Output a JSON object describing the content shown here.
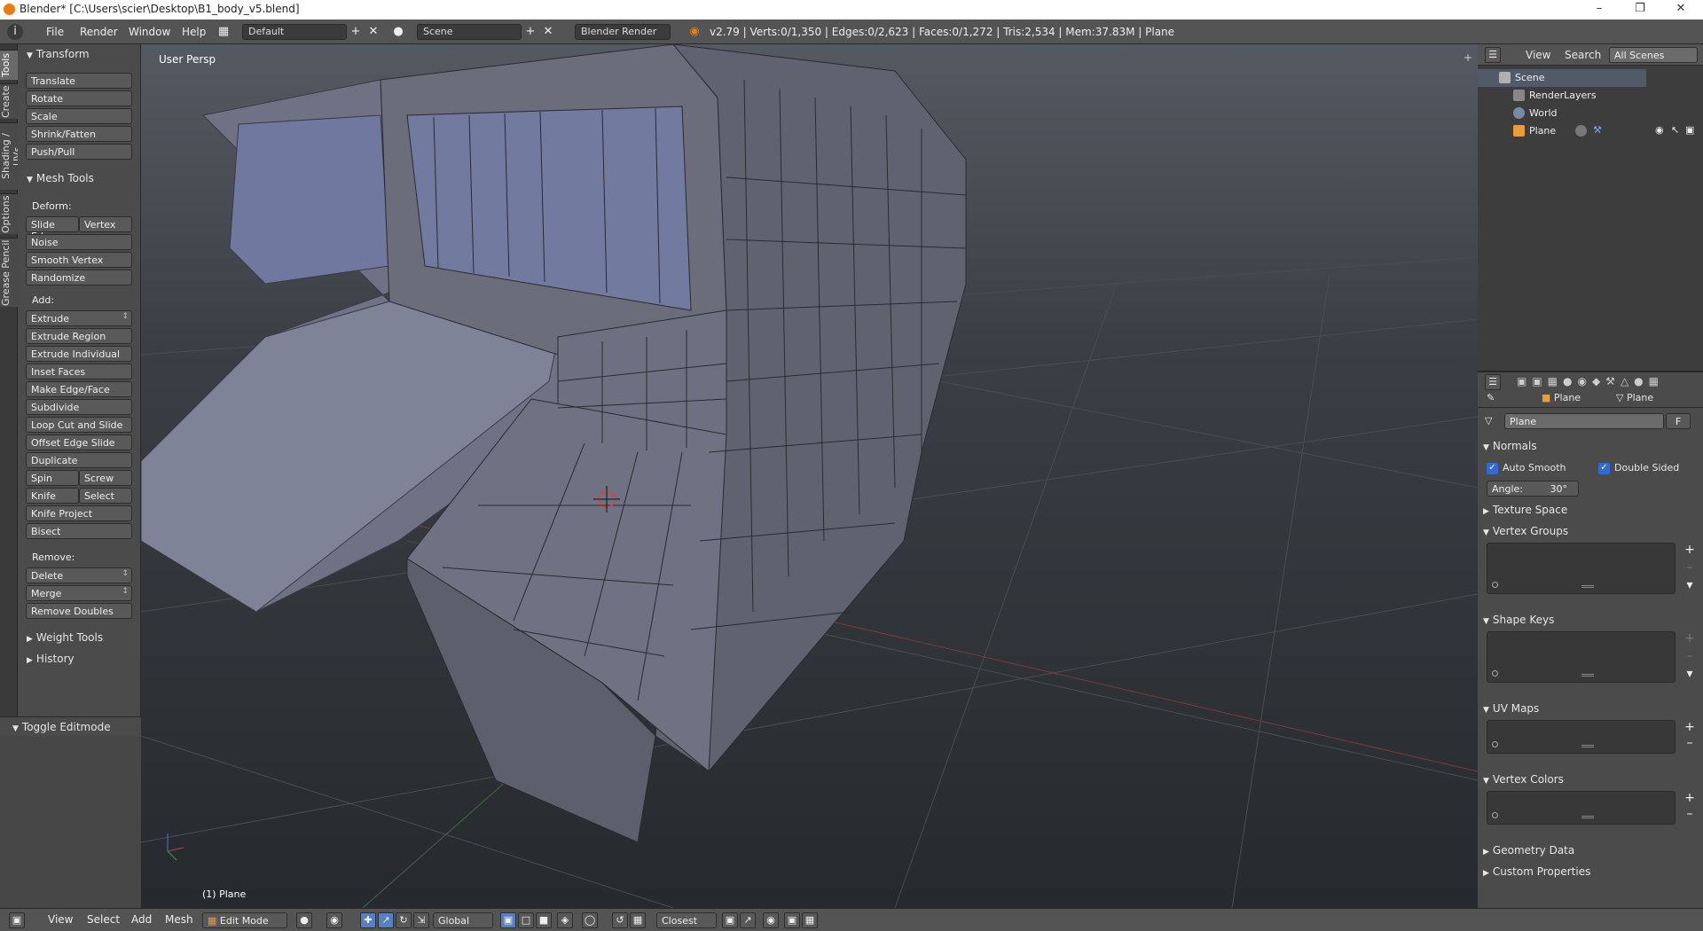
{
  "window": {
    "title": "Blender* [C:\\Users\\scier\\Desktop\\B1_body_v5.blend]"
  },
  "infobar": {
    "menus": [
      "File",
      "Render",
      "Window",
      "Help"
    ],
    "screen_layout": "Default",
    "scene": "Scene",
    "render_engine": "Blender Render",
    "stats": "v2.79 | Verts:0/1,350 | Edges:0/2,623 | Faces:0/1,272 | Tris:2,534 | Mem:37.83M | Plane"
  },
  "tabs": [
    "Tools",
    "Create",
    "Shading / UVs",
    "Options",
    "Grease Pencil"
  ],
  "toolshelf": {
    "transform": {
      "title": "Transform",
      "buttons": [
        "Translate",
        "Rotate",
        "Scale",
        "Shrink/Fatten",
        "Push/Pull"
      ]
    },
    "mesh_tools": {
      "title": "Mesh Tools",
      "deform_label": "Deform:",
      "deform": {
        "slide_edge": "Slide Edge",
        "vertex": "Vertex",
        "noise": "Noise",
        "smooth_vertex": "Smooth Vertex",
        "randomize": "Randomize"
      },
      "add_label": "Add:",
      "add": {
        "extrude": "Extrude",
        "extrude_region": "Extrude Region",
        "extrude_individual": "Extrude Individual",
        "inset_faces": "Inset Faces",
        "make_edge_face": "Make Edge/Face",
        "subdivide": "Subdivide",
        "loop_cut": "Loop Cut and Slide",
        "offset_edge_slide": "Offset Edge Slide",
        "duplicate": "Duplicate",
        "spin": "Spin",
        "screw": "Screw",
        "knife": "Knife",
        "select": "Select",
        "knife_project": "Knife Project",
        "bisect": "Bisect"
      },
      "remove_label": "Remove:",
      "remove": {
        "delete": "Delete",
        "merge": "Merge",
        "remove_doubles": "Remove Doubles"
      }
    },
    "weight_tools": "Weight Tools",
    "history": "History",
    "toggle_editmode": "Toggle Editmode"
  },
  "viewport": {
    "view_label": "User Persp",
    "object_label": "(1) Plane"
  },
  "outliner": {
    "view": "View",
    "search": "Search",
    "filter": "All Scenes",
    "rows": [
      "Scene",
      "RenderLayers",
      "World",
      "Plane"
    ]
  },
  "properties": {
    "context": [
      "Plane",
      "Plane"
    ],
    "datablock": "Plane",
    "fake_user": "F",
    "normals": {
      "title": "Normals",
      "auto_smooth": "Auto Smooth",
      "double_sided": "Double Sided",
      "angle_label": "Angle:",
      "angle_value": "30°"
    },
    "panels": {
      "texture_space": "Texture Space",
      "vertex_groups": "Vertex Groups",
      "shape_keys": "Shape Keys",
      "uv_maps": "UV Maps",
      "vertex_colors": "Vertex Colors",
      "geometry_data": "Geometry Data",
      "custom_properties": "Custom Properties"
    }
  },
  "header": {
    "menus": [
      "View",
      "Select",
      "Add",
      "Mesh"
    ],
    "mode": "Edit Mode",
    "orientation": "Global",
    "snap": "Closest"
  },
  "colors": {
    "accent_blue": "#5680c2",
    "mesh_face": "#6b6e7d",
    "mesh_inner": "#737aa0",
    "background_top": "#555a62"
  }
}
